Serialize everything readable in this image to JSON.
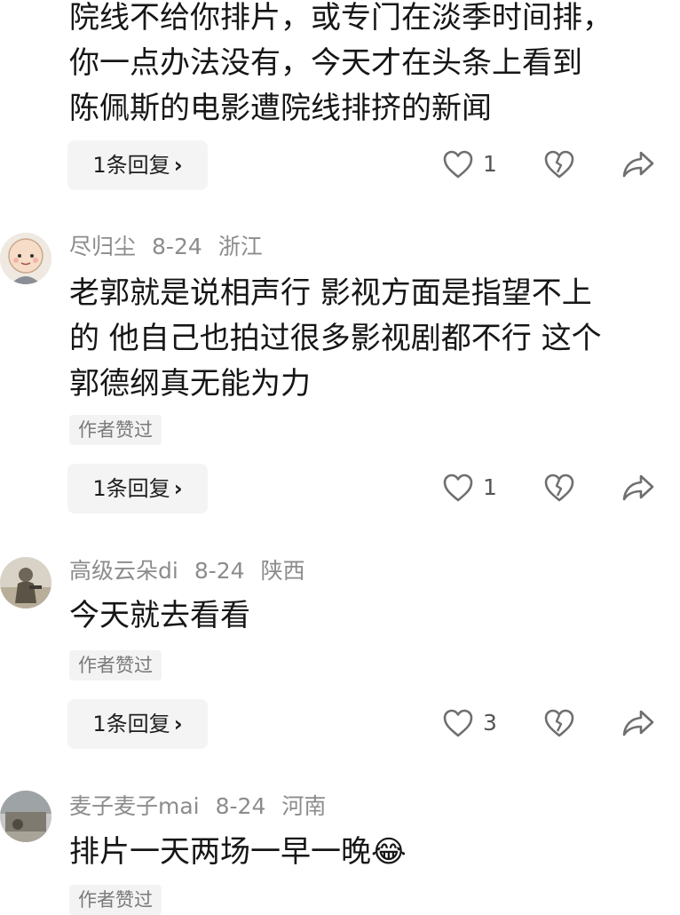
{
  "comments": [
    {
      "username": "",
      "date": "",
      "location": "",
      "lines": [
        "院线不给你排片，或专门在淡季时间排，",
        "你一点办法没有，今天才在头条上看到",
        "陈佩斯的电影遭院线排挤的新闻"
      ],
      "author_liked": "",
      "reply_label": "1条回复",
      "like_count": "1"
    },
    {
      "username": "尽归尘",
      "date": "8-24",
      "location": "浙江",
      "lines": [
        "老郭就是说相声行 影视方面是指望不上",
        "的 他自己也拍过很多影视剧都不行 这个",
        "郭德纲真无能为力"
      ],
      "author_liked": "作者赞过",
      "reply_label": "1条回复",
      "like_count": "1"
    },
    {
      "username": "高级云朵di",
      "date": "8-24",
      "location": "陕西",
      "lines": [
        "今天就去看看"
      ],
      "author_liked": "作者赞过",
      "reply_label": "1条回复",
      "like_count": "3"
    },
    {
      "username": "麦子麦子mai",
      "date": "8-24",
      "location": "河南",
      "lines": [
        "排片一天两场一早一晚😂"
      ],
      "author_liked": "作者赞过",
      "reply_label": "",
      "like_count": ""
    }
  ],
  "icons": {
    "reply_chevron": "chevron-right-icon",
    "like": "heart-icon",
    "dislike": "broken-heart-icon",
    "share": "share-arrow-icon"
  },
  "colors": {
    "text_primary": "#161616",
    "text_meta": "#8c8c8c",
    "button_bg": "#f4f4f4",
    "icon": "#6f6f6f"
  }
}
